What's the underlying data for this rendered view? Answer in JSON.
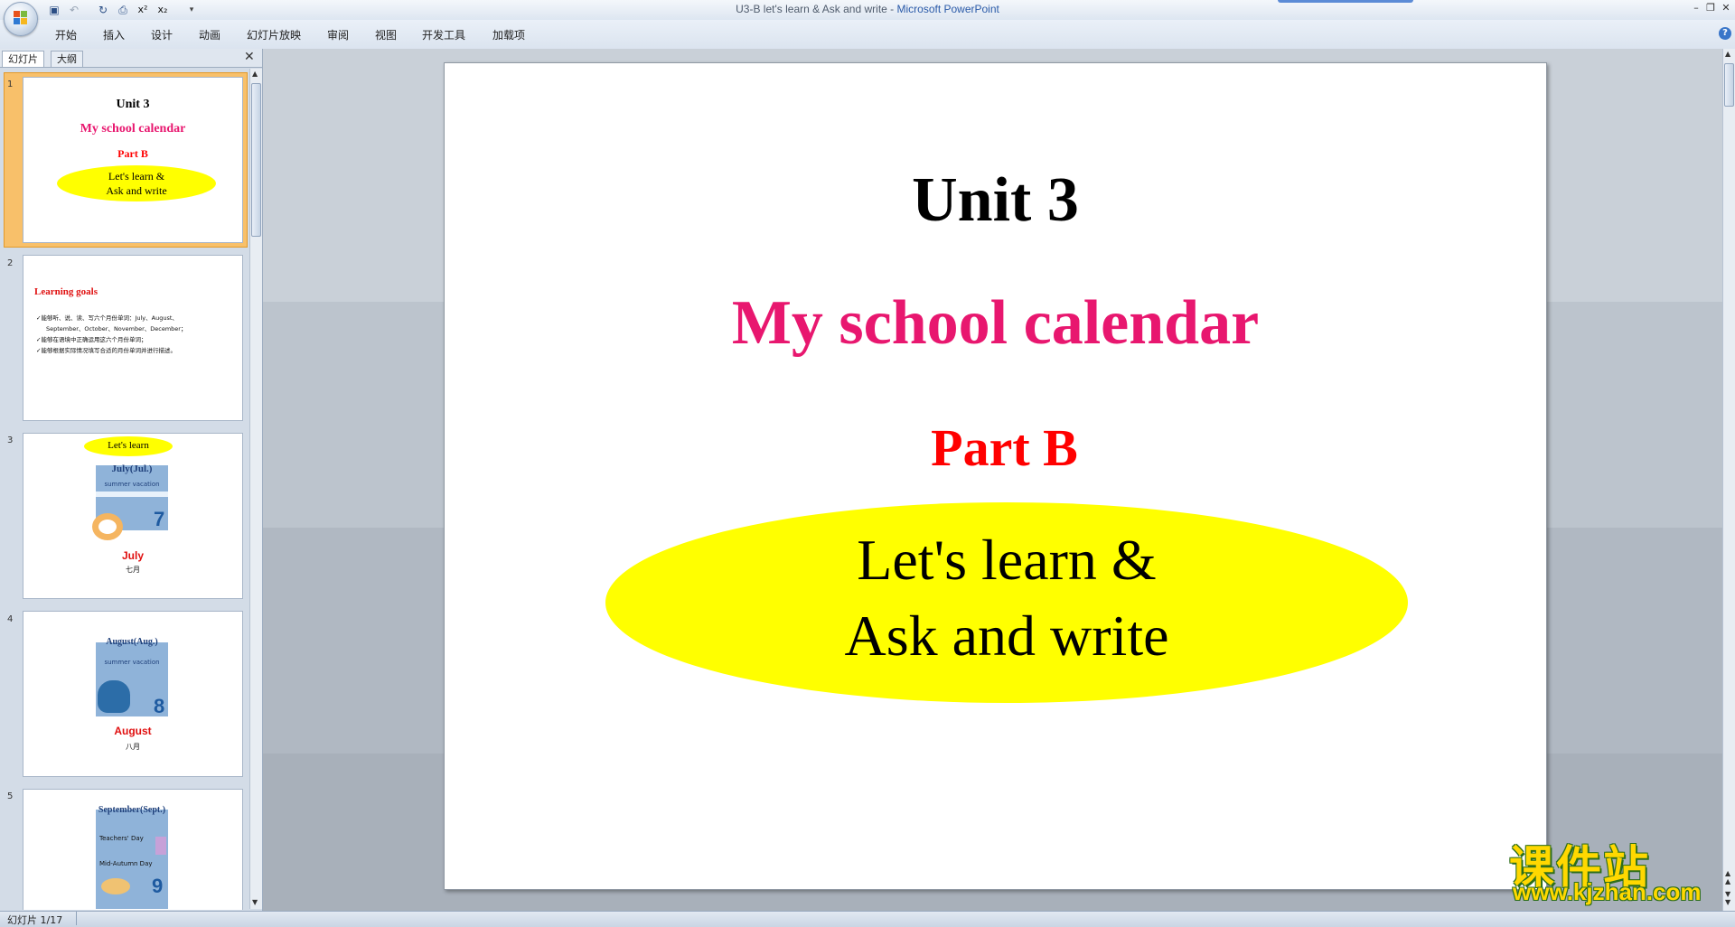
{
  "window": {
    "doc_title": "U3-B let's learn & Ask and write - ",
    "app_name": "Microsoft PowerPoint"
  },
  "ribbon": {
    "tabs": [
      "开始",
      "插入",
      "设计",
      "动画",
      "幻灯片放映",
      "审阅",
      "视图",
      "开发工具",
      "加载项"
    ]
  },
  "panel": {
    "tab_slides": "幻灯片",
    "tab_outline": "大纲"
  },
  "thumbnails": [
    {
      "num": "1",
      "title": "Unit 3",
      "subtitle": "My school calendar",
      "part": "Part B",
      "oval_line1": "Let's learn &",
      "oval_line2": "Ask and write"
    },
    {
      "num": "2",
      "heading": "Learning goals",
      "lines": [
        "✓能够听、说、读、写六个月份单词：July、August、",
        "September、October、November、December；",
        "✓能够在语境中正确运用这六个月份单词；",
        "✓能够根据实际情况填写合适的月份单词并进行描述。"
      ]
    },
    {
      "num": "3",
      "tag": "Let's learn",
      "card_title": "July(Jul.)",
      "card_sub": "summer vacation",
      "digit": "7",
      "month": "July",
      "cn": "七月"
    },
    {
      "num": "4",
      "card_title": "August(Aug.)",
      "card_sub": "summer vacation",
      "digit": "8",
      "month": "August",
      "cn": "八月"
    },
    {
      "num": "5",
      "card_title": "September(Sept.)",
      "card_sub": "Teachers' Day",
      "card_sub2": "Mid-Autumn Day",
      "digit": "9"
    }
  ],
  "slide": {
    "title": "Unit 3",
    "subtitle": "My school calendar",
    "part": "Part B",
    "oval_line1": "Let's learn &",
    "oval_line2": "Ask and write",
    "colors": {
      "title": "#000000",
      "subtitle": "#e8176f",
      "part": "#ff0000",
      "oval": "#ffff00"
    }
  },
  "status": {
    "slide_counter": "幻灯片 1/17"
  },
  "watermark": {
    "cn": "课件站",
    "url": "www.kjzhan.com"
  }
}
